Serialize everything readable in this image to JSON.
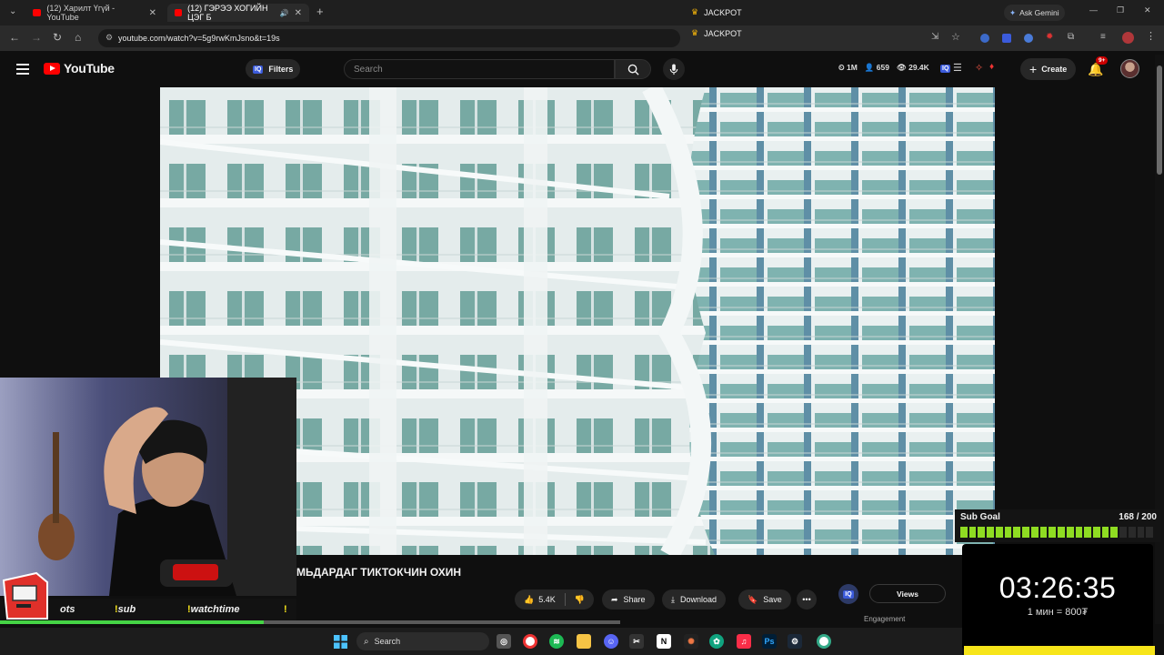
{
  "browser": {
    "tabs": [
      {
        "label": "(12) Харилт Үгүй - YouTube"
      },
      {
        "label": "(12) ГЭРЭЭ ХОГИЙН ЦЭГ Б"
      }
    ],
    "url": "youtube.com/watch?v=5g9rwKmJsno&t=19s",
    "bookmarks": [
      {
        "label": "JACKPOT"
      },
      {
        "label": "JACKPOT"
      }
    ],
    "ask_gemini": "Ask Gemini"
  },
  "youtube": {
    "logo_text": "YouTube",
    "filters_label": "Filters",
    "search_placeholder": "Search",
    "stats": {
      "subs": "1M",
      "watching": "659",
      "views": "29.4K"
    },
    "create_label": "Create",
    "notifications_badge": "9+"
  },
  "video": {
    "title": "МЬДАРДАГ ТИКТОКЧИН ОХИН",
    "likes": "5.4K",
    "share_label": "Share",
    "download_label": "Download",
    "save_label": "Save",
    "views_label": "Views",
    "engagement_label": "Engagement",
    "progress": 0.53
  },
  "overlay": {
    "sub_goal_label": "Sub Goal",
    "sub_goal_count": "168 / 200",
    "sub_goal_fraction": 0.84,
    "timer": "03:26:35",
    "rate": "1 мин = 800₮",
    "commands": [
      {
        "bang": "",
        "text": "ots"
      },
      {
        "bang": "!",
        "text": "sub"
      },
      {
        "bang": "!",
        "text": "watchtime"
      },
      {
        "bang": "!",
        "text": ""
      }
    ]
  },
  "taskbar": {
    "search_placeholder": "Search"
  },
  "colors": {
    "youtube_red": "#ff0000",
    "subgoal_green": "#8fdc22",
    "timer_yellow": "#f7e51a"
  }
}
